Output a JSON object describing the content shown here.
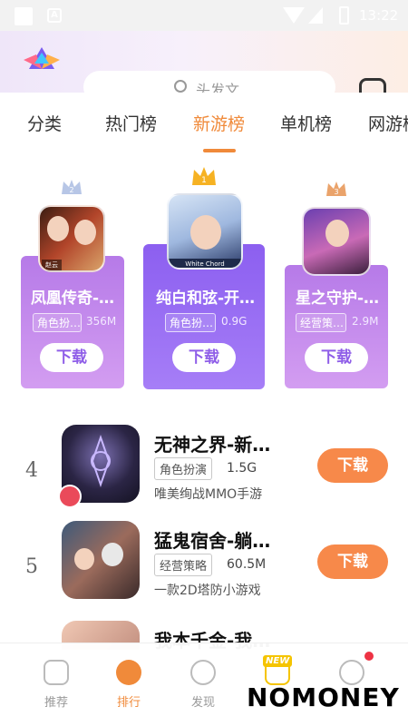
{
  "status_bar": {
    "time": "13:22",
    "badge_letter": "A"
  },
  "search": {
    "placeholder": "头发文"
  },
  "tabs": [
    {
      "label": "分类",
      "active": false
    },
    {
      "label": "热门榜",
      "active": false
    },
    {
      "label": "新游榜",
      "active": true
    },
    {
      "label": "单机榜",
      "active": false
    },
    {
      "label": "网游榜",
      "active": false
    }
  ],
  "podium": [
    {
      "rank": "2",
      "title": "凤凰传奇-…",
      "tag": "角色扮…",
      "size": "356M",
      "button": "下载",
      "icon_caption": "赵云"
    },
    {
      "rank": "1",
      "title": "纯白和弦-开…",
      "tag": "角色扮…",
      "size": "0.9G",
      "button": "下载",
      "icon_caption": "White Chord"
    },
    {
      "rank": "3",
      "title": "星之守护-…",
      "tag": "经营策…",
      "size": "2.9M",
      "button": "下载",
      "icon_caption": ""
    }
  ],
  "list": [
    {
      "rank": "4",
      "title": "无神之界-新…",
      "tag": "角色扮演",
      "size": "1.5G",
      "desc": "唯美绚战MMO手游",
      "button": "下载"
    },
    {
      "rank": "5",
      "title": "猛鬼宿舍-躺…",
      "tag": "经营策略",
      "size": "60.5M",
      "desc": "一款2D塔防小游戏",
      "button": "下载"
    },
    {
      "rank": "",
      "title": "我本千金-我…",
      "tag": "",
      "size": "",
      "desc": "",
      "button": ""
    }
  ],
  "bottom_nav": [
    {
      "label": "推荐",
      "icon": "gamepad-icon",
      "active": false
    },
    {
      "label": "排行",
      "icon": "rank-icon",
      "active": true
    },
    {
      "label": "发现",
      "icon": "compass-icon",
      "active": false
    },
    {
      "label": "",
      "icon": "gift-new-icon",
      "active": false
    },
    {
      "label": "",
      "icon": "message-icon",
      "active": false
    }
  ],
  "new_badge": "NEW",
  "watermark": "NOMONEY",
  "colors": {
    "accent": "#f08a3a",
    "podium_purple": "#8c5ff0",
    "download_orange": "#f7894a"
  }
}
